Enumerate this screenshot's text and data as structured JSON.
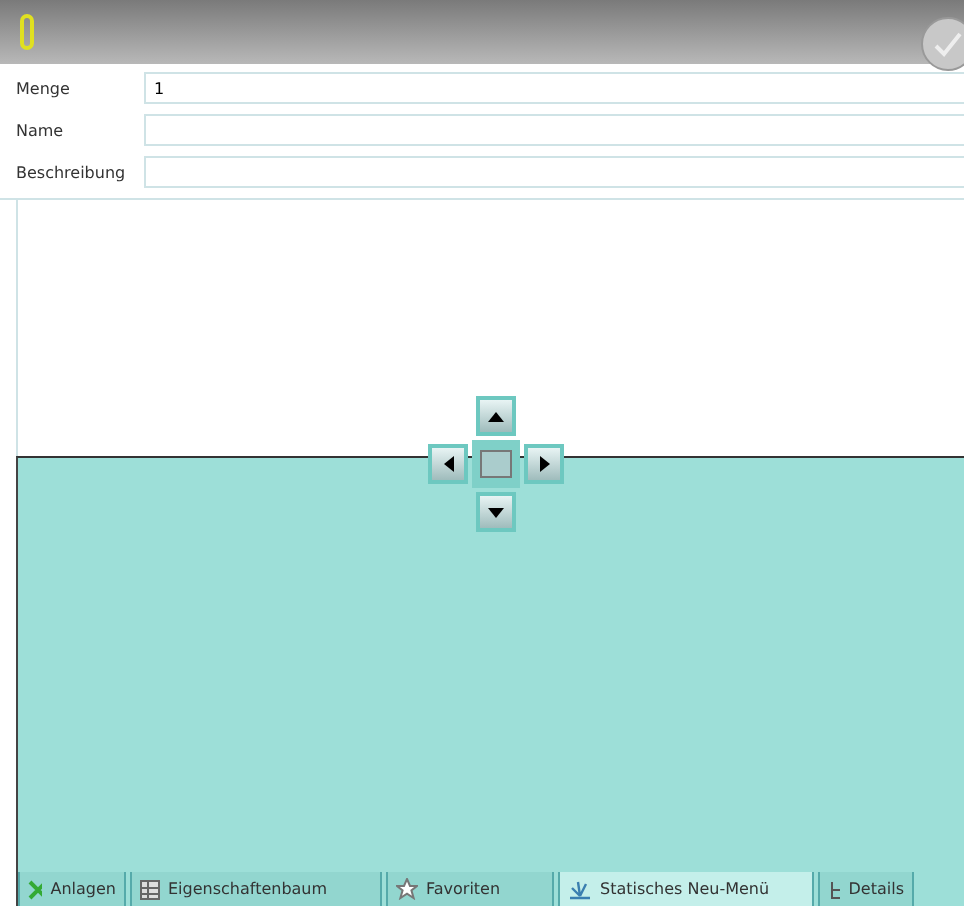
{
  "fields": [
    {
      "label": "Menge",
      "value": "1"
    },
    {
      "label": "Name"
    },
    {
      "label": "Beschreibung"
    }
  ],
  "tabs": [
    {
      "label": "Anlagen",
      "selected": false,
      "kind": "grid"
    },
    {
      "label": "Eigenschaftenbaum",
      "selected": false,
      "kind": "table"
    },
    {
      "label": "Favoriten",
      "selected": false,
      "kind": "star"
    },
    {
      "label": "Statisches Neu-Menü",
      "selected": true,
      "kind": "spark"
    },
    {
      "label": "Details",
      "selected": false,
      "kind": "tree"
    }
  ]
}
